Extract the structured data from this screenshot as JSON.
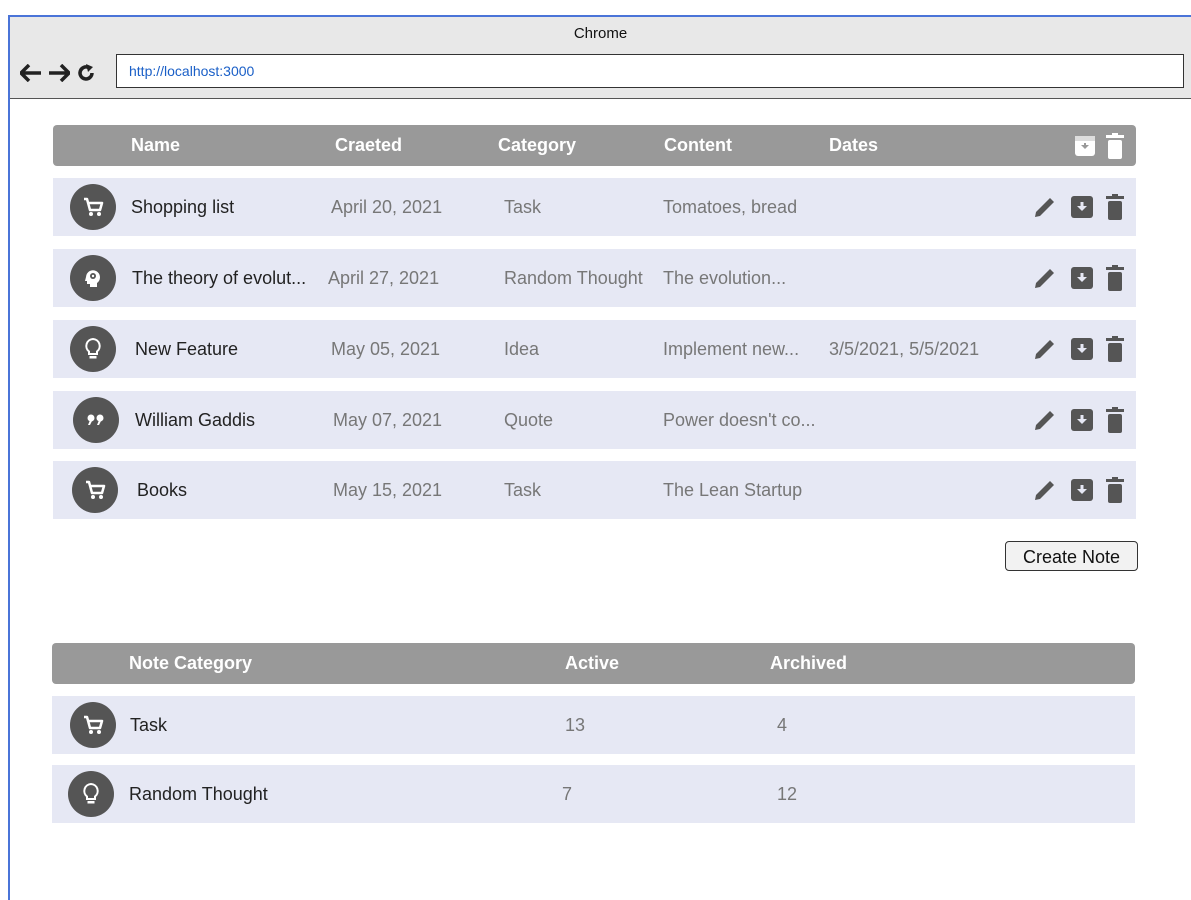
{
  "browser": {
    "title": "Chrome",
    "url": "http://localhost:3000"
  },
  "notes_table": {
    "headers": {
      "name": "Name",
      "created": "Craeted",
      "category": "Category",
      "content": "Content",
      "dates": "Dates"
    },
    "rows": [
      {
        "icon": "cart-icon",
        "name": "Shopping list",
        "created": "April 20, 2021",
        "category": "Task",
        "content": "Tomatoes, bread",
        "dates": ""
      },
      {
        "icon": "brain-gear-icon",
        "name": "The theory of evolut...",
        "created": "April 27, 2021",
        "category": "Random Thought",
        "content": "The evolution...",
        "dates": ""
      },
      {
        "icon": "lightbulb-icon",
        "name": "New Feature",
        "created": "May 05, 2021",
        "category": "Idea",
        "content": "Implement new...",
        "dates": "3/5/2021, 5/5/2021"
      },
      {
        "icon": "quote-icon",
        "name": "William Gaddis",
        "created": "May 07, 2021",
        "category": "Quote",
        "content": "Power doesn't co...",
        "dates": ""
      },
      {
        "icon": "cart-icon",
        "name": "Books",
        "created": "May 15, 2021",
        "category": "Task",
        "content": "The Lean Startup",
        "dates": ""
      }
    ]
  },
  "create_button": "Create Note",
  "summary_table": {
    "headers": {
      "category": "Note Category",
      "active": "Active",
      "archived": "Archived"
    },
    "rows": [
      {
        "icon": "cart-icon",
        "category": "Task",
        "active": "13",
        "archived": "4"
      },
      {
        "icon": "lightbulb-icon",
        "category": "Random Thought",
        "active": "7",
        "archived": "12"
      }
    ]
  },
  "colors": {
    "header_bg": "#999999",
    "row_bg": "#e6e8f4",
    "avatar_bg": "#555555",
    "action_icon": "#555555",
    "url_text": "#1a5fc7",
    "frame_border": "#4a74d8"
  }
}
